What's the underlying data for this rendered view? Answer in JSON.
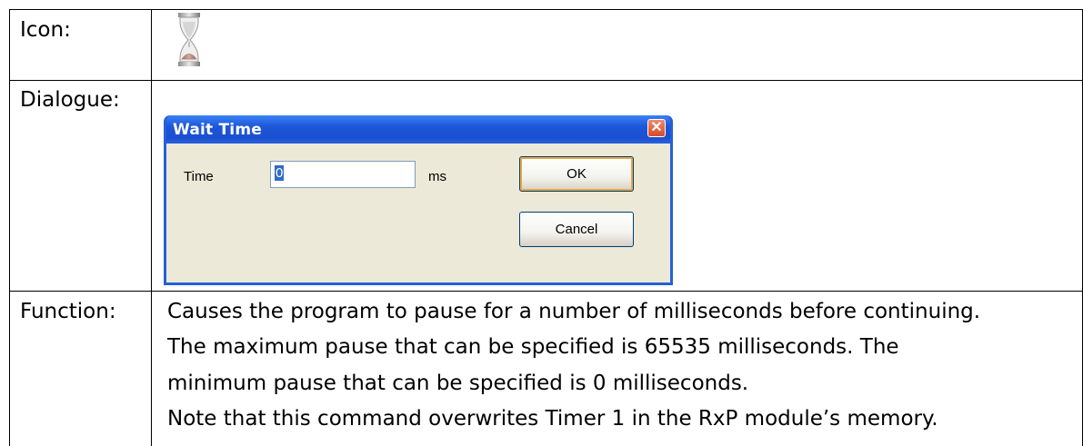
{
  "rows": {
    "icon_label": "Icon:",
    "dialogue_label": "Dialogue:",
    "function_label": "Function:"
  },
  "icon": {
    "name": "hourglass-icon"
  },
  "dialog": {
    "title": "Wait Time",
    "time_label": "Time",
    "time_value": "0",
    "unit_label": "ms",
    "ok_label": "OK",
    "cancel_label": "Cancel"
  },
  "function_text": [
    "Causes the program to pause for a number of milliseconds before continuing.",
    "The maximum pause that can be specified is 65535 milliseconds. The",
    "minimum pause that can be specified is 0 milliseconds.",
    "Note that this command overwrites Timer 1 in the RxP module’s memory."
  ],
  "colors": {
    "titlebar": "#1d56d8",
    "dialog_face": "#ece9d8",
    "close_button": "#d64a27"
  }
}
